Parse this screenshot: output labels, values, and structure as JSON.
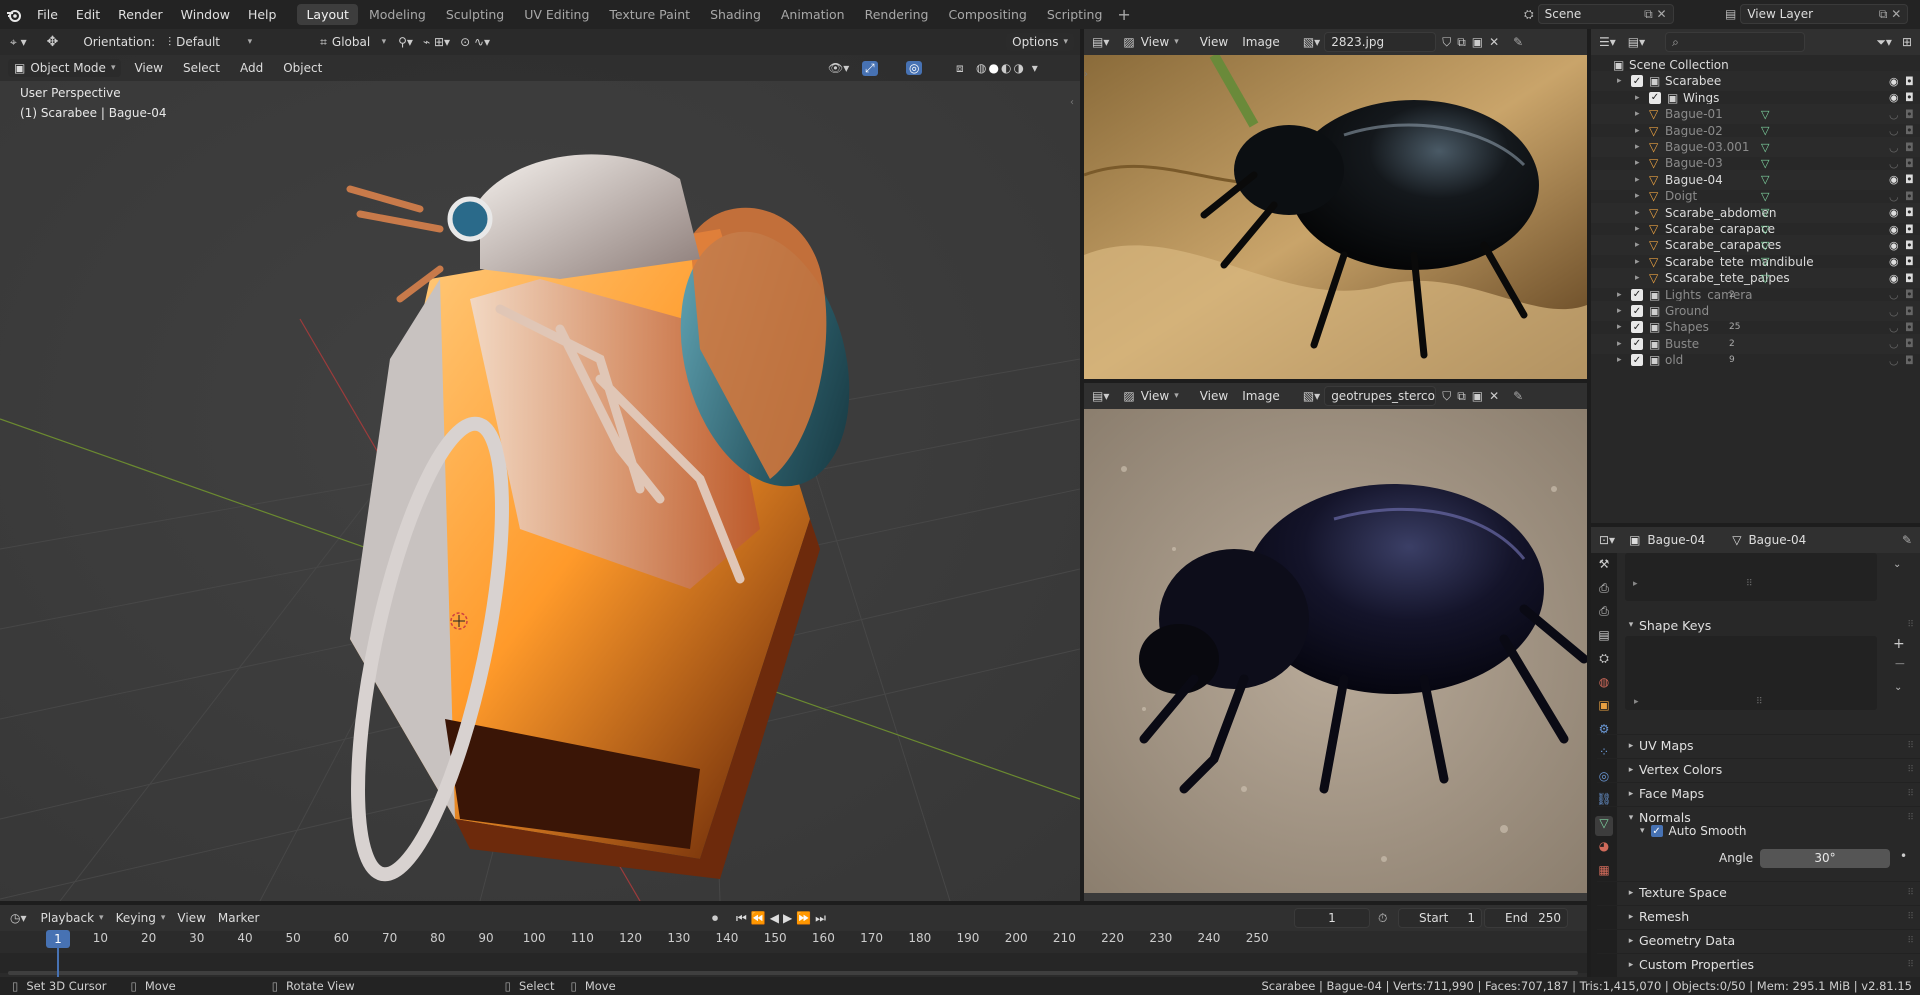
{
  "topbar": {
    "menus": [
      "File",
      "Edit",
      "Render",
      "Window",
      "Help"
    ],
    "workspaces": [
      "Layout",
      "Modeling",
      "Sculpting",
      "UV Editing",
      "Texture Paint",
      "Shading",
      "Animation",
      "Rendering",
      "Compositing",
      "Scripting"
    ],
    "active_workspace": "Layout",
    "scene_name": "Scene",
    "view_layer_name": "View Layer"
  },
  "viewport": {
    "orientation_label": "Orientation:",
    "orientation_value": "Default",
    "transform_space": "Global",
    "options_label": "Options",
    "mode": "Object Mode",
    "menus": [
      "View",
      "Select",
      "Add",
      "Object"
    ],
    "perspective_label": "User Perspective",
    "active_info": "(1) Scarabee | Bague-04"
  },
  "image_editor_top": {
    "menus": [
      "View",
      "View",
      "Image"
    ],
    "image_name": "2823.jpg"
  },
  "image_editor_bottom": {
    "menus": [
      "View",
      "View",
      "Image"
    ],
    "image_name": "geotrupes_stercoros..."
  },
  "outliner": {
    "root": "Scene Collection",
    "collection": "Scarabee",
    "items": [
      {
        "name": "Wings",
        "dim": false,
        "checkbox": true
      },
      {
        "name": "Bague-01",
        "dim": true
      },
      {
        "name": "Bague-02",
        "dim": true
      },
      {
        "name": "Bague-03.001",
        "dim": true
      },
      {
        "name": "Bague-03",
        "dim": true
      },
      {
        "name": "Bague-04",
        "dim": false
      },
      {
        "name": "Doigt",
        "dim": true
      },
      {
        "name": "Scarabe_abdomen",
        "dim": false
      },
      {
        "name": "Scarabe_carapace",
        "dim": false
      },
      {
        "name": "Scarabe_carapaces",
        "dim": false
      },
      {
        "name": "Scarabe_tete_mandibule",
        "dim": false
      },
      {
        "name": "Scarabe_tete_palpes",
        "dim": false
      }
    ],
    "collections": [
      {
        "name": "Lights_camera",
        "badge": "2"
      },
      {
        "name": "Ground",
        "badge": ""
      },
      {
        "name": "Shapes",
        "badge": "25"
      },
      {
        "name": "Buste",
        "badge": "2"
      },
      {
        "name": "old",
        "badge": "9"
      }
    ]
  },
  "properties": {
    "object_name": "Bague-04",
    "data_name": "Bague-04",
    "sections": [
      {
        "label": "Shape Keys",
        "open": true
      },
      {
        "label": "UV Maps",
        "open": false
      },
      {
        "label": "Vertex Colors",
        "open": false
      },
      {
        "label": "Face Maps",
        "open": false
      },
      {
        "label": "Normals",
        "open": true
      }
    ],
    "auto_smooth_label": "Auto Smooth",
    "angle_label": "Angle",
    "angle_value": "30°",
    "lower_sections": [
      "Texture Space",
      "Remesh",
      "Geometry Data",
      "Custom Properties"
    ]
  },
  "timeline": {
    "menus": [
      "Playback",
      "Keying",
      "View",
      "Marker"
    ],
    "current_frame": "1",
    "start_label": "Start",
    "start_value": "1",
    "end_label": "End",
    "end_value": "250",
    "ticks": [
      "10",
      "20",
      "30",
      "40",
      "50",
      "60",
      "70",
      "80",
      "90",
      "100",
      "110",
      "120",
      "130",
      "140",
      "150",
      "160",
      "170",
      "180",
      "190",
      "200",
      "210",
      "220",
      "230",
      "240",
      "250"
    ]
  },
  "statusbar": {
    "left": [
      "Set 3D Cursor",
      "Move",
      "Rotate View",
      "Select",
      "Move"
    ],
    "stats": "Scarabee | Bague-04 | Verts:711,990 | Faces:707,187 | Tris:1,415,070 | Objects:0/50 | Mem: 295.1 MiB | v2.81.15"
  },
  "colors": {
    "accent": "#4772b3",
    "active_frame": "#4772b3",
    "object_orange": "#e8a041",
    "mesh_green": "#7fd3a0"
  }
}
